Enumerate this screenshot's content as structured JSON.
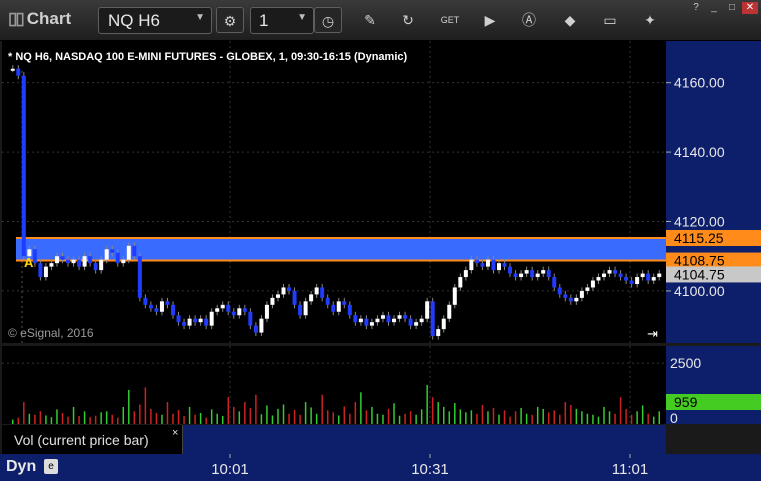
{
  "toolbar": {
    "app_title": "Chart",
    "symbol": "NQ H6",
    "interval": "1",
    "buttons": [
      "gear-icon",
      "clock-icon",
      "pencil-icon",
      "refresh-icon",
      "get-icon",
      "play-icon",
      "alert-icon",
      "eraser-icon",
      "comment-icon",
      "pin-icon"
    ]
  },
  "window": {
    "help": "?",
    "minimize": "_",
    "maximize": "□",
    "close": "✕"
  },
  "chart": {
    "header": "* NQ H6, NASDAQ 100 E-MINI FUTURES - GLOBEX, 1, 09:30-16:15 (Dynamic)",
    "copyright": "© eSignal, 2016",
    "marker": "A",
    "price_ticks": [
      "4160.00",
      "4140.00",
      "4120.00",
      "4100.00"
    ],
    "price_labels": [
      {
        "text": "4115.25",
        "color": "#ff8c1a"
      },
      {
        "text": "4108.75",
        "color": "#ff8c1a"
      },
      {
        "text": "4104.75",
        "color": "#c8c8c8"
      }
    ],
    "colors": {
      "up": "#ffffff",
      "down": "#1f3cff",
      "band": "#3a6bff",
      "line": "#ff8c1a",
      "axis_bg": "#0d1f6b"
    }
  },
  "volume": {
    "ticks": [
      "2500",
      "0"
    ],
    "current": "959",
    "study_label": "Vol (current price bar)",
    "study_close": "×"
  },
  "time_axis": {
    "mode": "Dyn",
    "labels": [
      "10:01",
      "10:31",
      "11:01"
    ]
  },
  "chart_data": {
    "type": "candlestick",
    "ylim": [
      4085,
      4172
    ],
    "y_ticks": [
      4100,
      4120,
      4140,
      4160
    ],
    "x_labels": [
      "10:01",
      "10:31",
      "11:01"
    ],
    "levels": [
      4115.25,
      4108.75
    ],
    "last": 4104.75,
    "close": [
      4164,
      4162,
      4110,
      4112,
      4108,
      4104,
      4107,
      4108,
      4110,
      4109,
      4108,
      4109,
      4107,
      4110,
      4108,
      4106,
      4109,
      4112,
      4111,
      4108,
      4109,
      4113,
      4110,
      4098,
      4096,
      4095,
      4094,
      4097,
      4096,
      4093,
      4091,
      4090,
      4092,
      4091,
      4092,
      4090,
      4094,
      4095,
      4096,
      4094,
      4093,
      4095,
      4094,
      4090,
      4088,
      4092,
      4096,
      4098,
      4099,
      4101,
      4100,
      4096,
      4093,
      4097,
      4099,
      4101,
      4098,
      4096,
      4094,
      4097,
      4096,
      4093,
      4091,
      4092,
      4090,
      4091,
      4092,
      4093,
      4091,
      4092,
      4093,
      4092,
      4090,
      4091,
      4092,
      4097,
      4087,
      4089,
      4092,
      4096,
      4101,
      4104,
      4106,
      4109,
      4108,
      4107,
      4109,
      4106,
      4108,
      4107,
      4105,
      4104,
      4105,
      4106,
      4104,
      4105,
      4106,
      4104,
      4101,
      4099,
      4098,
      4097,
      4098,
      4100,
      4101,
      4103,
      4104,
      4105,
      4106,
      4105,
      4104,
      4103,
      4102,
      4104,
      4105,
      4103,
      4104,
      4105
    ],
    "volume": [
      180,
      260,
      900,
      420,
      380,
      520,
      350,
      280,
      600,
      450,
      300,
      700,
      330,
      520,
      280,
      340,
      480,
      520,
      380,
      260,
      700,
      1400,
      520,
      800,
      1500,
      620,
      450,
      380,
      900,
      420,
      580,
      330,
      700,
      380,
      450,
      260,
      600,
      420,
      330,
      1100,
      700,
      520,
      900,
      650,
      1200,
      400,
      760,
      350,
      620,
      800,
      420,
      580,
      380,
      900,
      680,
      420,
      1200,
      560,
      480,
      350,
      720,
      420,
      900,
      1300,
      560,
      700,
      420,
      380,
      620,
      850,
      340,
      420,
      520,
      380,
      600,
      1600,
      1100,
      900,
      700,
      520,
      860,
      600,
      480,
      560,
      420,
      780,
      520,
      660,
      380,
      560,
      300,
      520,
      660,
      420,
      380,
      700,
      620,
      480,
      560,
      380,
      900,
      780,
      620,
      520,
      420,
      380,
      300,
      700,
      520,
      420,
      1100,
      620,
      380,
      520,
      760,
      420,
      300,
      520
    ]
  }
}
